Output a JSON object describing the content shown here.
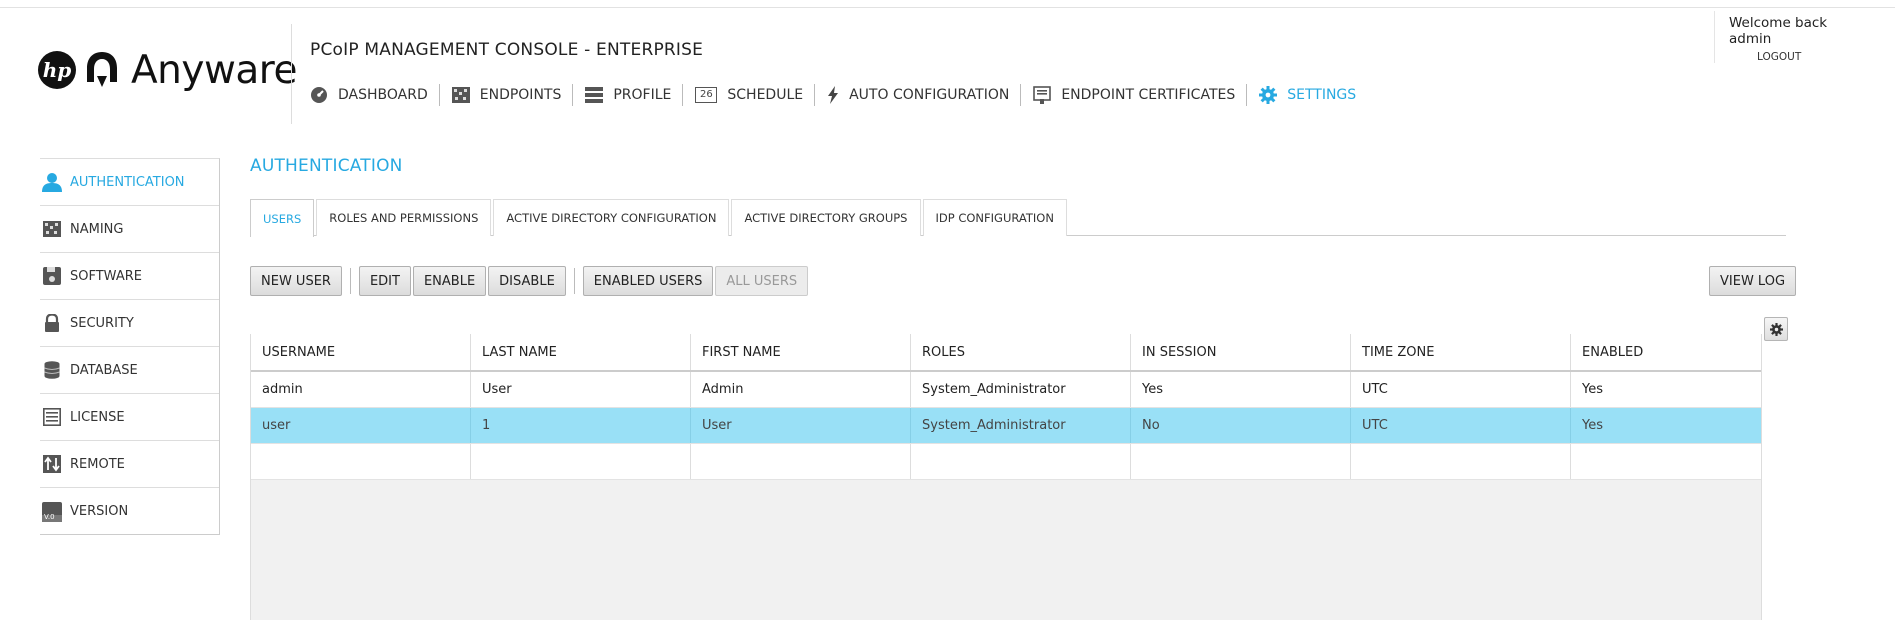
{
  "brand": {
    "name": "Anyware",
    "hp_mark": "hp"
  },
  "console_title": "PCoIP MANAGEMENT CONSOLE - ENTERPRISE",
  "welcome": {
    "text": "Welcome back admin",
    "logout": "LOGOUT"
  },
  "nav": [
    {
      "label": "DASHBOARD",
      "icon": "dashboard-icon"
    },
    {
      "label": "ENDPOINTS",
      "icon": "endpoints-icon"
    },
    {
      "label": "PROFILE",
      "icon": "profile-icon"
    },
    {
      "label": "SCHEDULE",
      "icon": "calendar-icon",
      "icon_text": "26"
    },
    {
      "label": "AUTO CONFIGURATION",
      "icon": "lightning-icon"
    },
    {
      "label": "ENDPOINT CERTIFICATES",
      "icon": "certificate-icon"
    },
    {
      "label": "SETTINGS",
      "icon": "gear-icon",
      "active": true
    }
  ],
  "sidebar": [
    {
      "label": "AUTHENTICATION",
      "icon": "user-icon",
      "active": true
    },
    {
      "label": "NAMING",
      "icon": "naming-icon"
    },
    {
      "label": "SOFTWARE",
      "icon": "software-icon"
    },
    {
      "label": "SECURITY",
      "icon": "lock-icon"
    },
    {
      "label": "DATABASE",
      "icon": "database-icon"
    },
    {
      "label": "LICENSE",
      "icon": "license-icon"
    },
    {
      "label": "REMOTE",
      "icon": "remote-icon"
    },
    {
      "label": "VERSION",
      "icon": "version-icon",
      "icon_text": "V.0"
    }
  ],
  "page_title": "AUTHENTICATION",
  "tabs": [
    {
      "label": "USERS",
      "active": true
    },
    {
      "label": "ROLES AND PERMISSIONS"
    },
    {
      "label": "ACTIVE DIRECTORY CONFIGURATION"
    },
    {
      "label": "ACTIVE DIRECTORY GROUPS"
    },
    {
      "label": "IDP CONFIGURATION"
    }
  ],
  "toolbar": {
    "new_user": "NEW USER",
    "edit": "EDIT",
    "enable": "ENABLE",
    "disable": "DISABLE",
    "enabled_users": "ENABLED USERS",
    "all_users": "ALL USERS",
    "view_log": "VIEW LOG"
  },
  "table": {
    "columns": [
      "USERNAME",
      "LAST NAME",
      "FIRST NAME",
      "ROLES",
      "IN SESSION",
      "TIME ZONE",
      "ENABLED"
    ],
    "rows": [
      [
        "admin",
        "User",
        "Admin",
        "System_Administrator",
        "Yes",
        "UTC",
        "Yes"
      ],
      [
        "user",
        "1",
        "User",
        "System_Administrator",
        "No",
        "UTC",
        "Yes"
      ]
    ],
    "selected_row": 1
  },
  "colors": {
    "accent": "#27a9e1",
    "selected_row": "#99e0f6"
  }
}
